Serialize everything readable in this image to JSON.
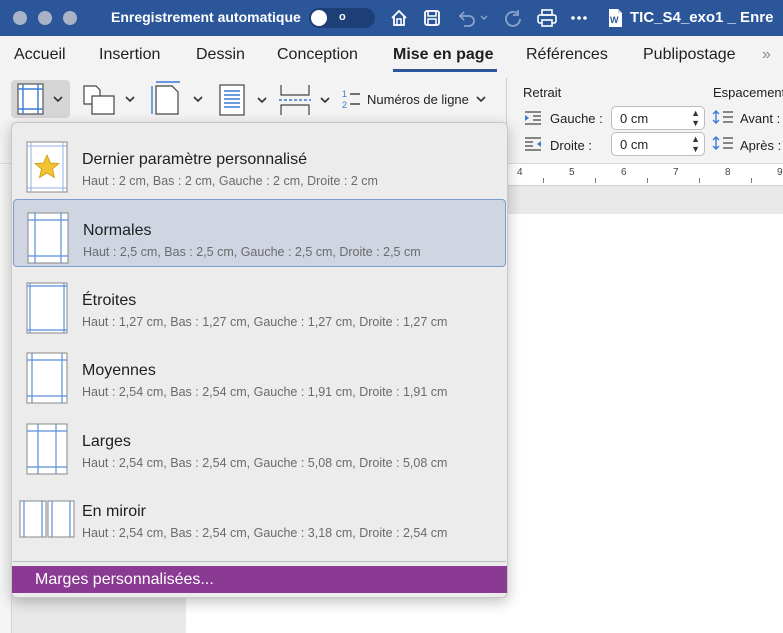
{
  "titlebar": {
    "autosave_label": "Enregistrement automatique",
    "toggle_state": "o",
    "doc_title": "TIC_S4_exo1 _ Enre",
    "bg_color": "#2b579a"
  },
  "tabs": [
    {
      "label": "Accueil"
    },
    {
      "label": "Insertion"
    },
    {
      "label": "Dessin"
    },
    {
      "label": "Conception"
    },
    {
      "label": "Mise en page"
    },
    {
      "label": "Références"
    },
    {
      "label": "Publipostage"
    }
  ],
  "tabs_more": "»",
  "ribbon": {
    "line_numbers_label": "Numéros de ligne",
    "retrait_title": "Retrait",
    "espacement_title": "Espacement",
    "gauche_label": "Gauche :",
    "droite_label": "Droite :",
    "gauche_value": "0 cm",
    "droite_value": "0 cm",
    "avant_label": "Avant :",
    "apres_label": "Après :"
  },
  "ruler": {
    "numbers": [
      "4",
      "5",
      "6",
      "7",
      "8",
      "9"
    ]
  },
  "margins_menu": {
    "options": [
      {
        "name": "Dernier paramètre personnalisé",
        "desc": "Haut : 2 cm, Bas : 2 cm, Gauche : 2 cm, Droite : 2 cm",
        "icon": "star-icon"
      },
      {
        "name": "Normales",
        "desc": "Haut : 2,5 cm, Bas : 2,5 cm, Gauche : 2,5 cm, Droite : 2,5 cm",
        "icon": "margin-normal-icon",
        "selected": true
      },
      {
        "name": "Étroites",
        "desc": "Haut : 1,27 cm, Bas : 1,27 cm, Gauche : 1,27 cm, Droite : 1,27 cm",
        "icon": "margin-narrow-icon"
      },
      {
        "name": "Moyennes",
        "desc": "Haut : 2,54 cm, Bas : 2,54 cm, Gauche : 1,91 cm, Droite : 1,91 cm",
        "icon": "margin-moderate-icon"
      },
      {
        "name": "Larges",
        "desc": "Haut : 2,54 cm, Bas : 2,54 cm, Gauche : 5,08 cm, Droite : 5,08 cm",
        "icon": "margin-wide-icon"
      },
      {
        "name": "En miroir",
        "desc": "Haut : 2,54 cm, Bas : 2,54 cm, Gauche : 3,18 cm, Droite : 2,54 cm",
        "icon": "margin-mirrored-icon"
      }
    ],
    "custom_label": "Marges personnalisées...",
    "custom_color": "#8a3a92",
    "selected_color": "#cfd5e1"
  }
}
